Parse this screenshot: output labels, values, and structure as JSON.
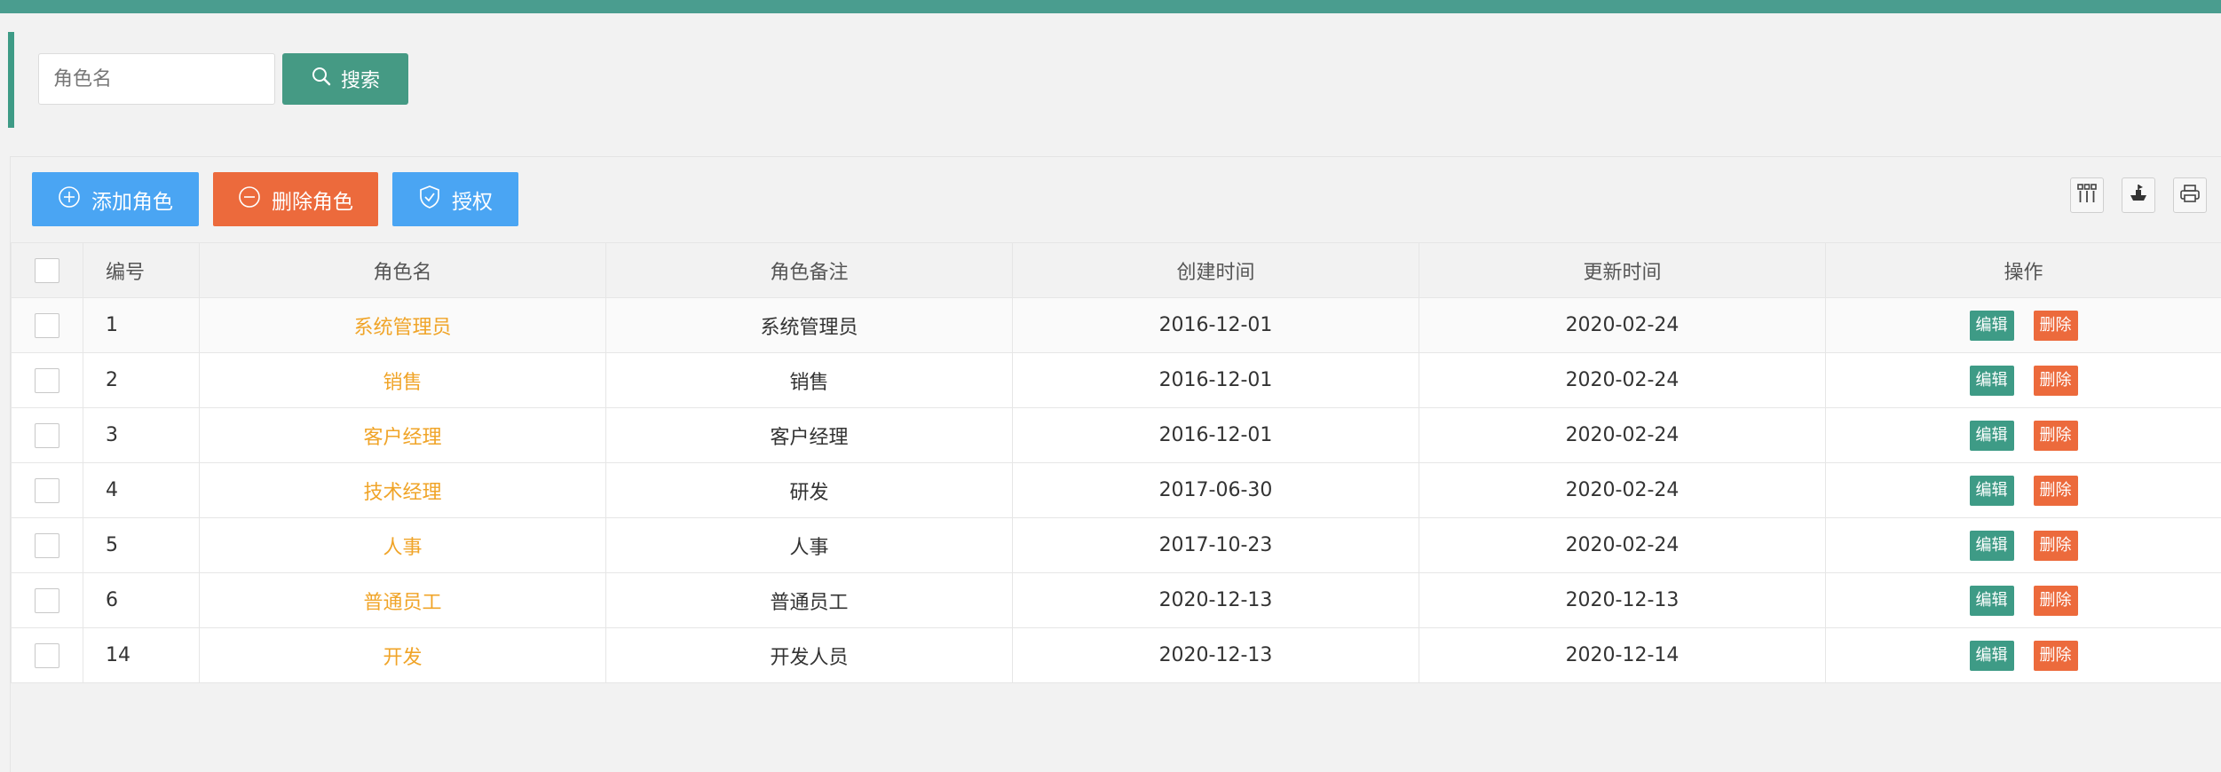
{
  "search": {
    "placeholder": "角色名",
    "button_label": "搜索"
  },
  "toolbar": {
    "add_label": "添加角色",
    "delete_label": "删除角色",
    "auth_label": "授权"
  },
  "table": {
    "headers": {
      "id": "编号",
      "role_name": "角色名",
      "role_remark": "角色备注",
      "created": "创建时间",
      "updated": "更新时间",
      "actions": "操作"
    },
    "edit_label": "编辑",
    "delete_label": "删除",
    "rows": [
      {
        "id": "1",
        "role_name": "系统管理员",
        "role_remark": "系统管理员",
        "created": "2016-12-01",
        "updated": "2020-02-24"
      },
      {
        "id": "2",
        "role_name": "销售",
        "role_remark": "销售",
        "created": "2016-12-01",
        "updated": "2020-02-24"
      },
      {
        "id": "3",
        "role_name": "客户经理",
        "role_remark": "客户经理",
        "created": "2016-12-01",
        "updated": "2020-02-24"
      },
      {
        "id": "4",
        "role_name": "技术经理",
        "role_remark": "研发",
        "created": "2017-06-30",
        "updated": "2020-02-24"
      },
      {
        "id": "5",
        "role_name": "人事",
        "role_remark": "人事",
        "created": "2017-10-23",
        "updated": "2020-02-24"
      },
      {
        "id": "6",
        "role_name": "普通员工",
        "role_remark": "普通员工",
        "created": "2020-12-13",
        "updated": "2020-12-13"
      },
      {
        "id": "14",
        "role_name": "开发",
        "role_remark": "开发人员",
        "created": "2020-12-13",
        "updated": "2020-12-14"
      }
    ]
  },
  "icons": {
    "search": "search-icon",
    "add": "plus-circle-icon",
    "delete": "minus-circle-icon",
    "auth": "shield-check-icon",
    "columns": "columns-filter-icon",
    "export": "export-icon",
    "print": "print-icon"
  },
  "colors": {
    "top_bar": "#4a9d8f",
    "search_button": "#459a84",
    "primary_blue": "#4aa5f3",
    "danger_orange": "#ec6a3c",
    "role_name_text": "#f0a428",
    "edit_button": "#3e9b86"
  }
}
